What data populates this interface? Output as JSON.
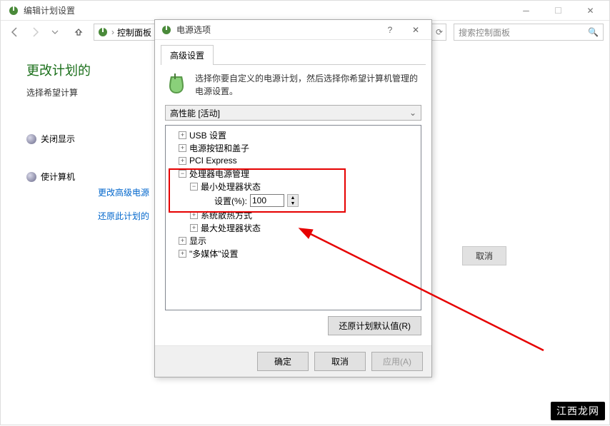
{
  "main": {
    "title": "编辑计划设置",
    "breadcrumb": {
      "level1": "控制面板"
    },
    "search_placeholder": "搜索控制面板",
    "heading": "更改计划的",
    "subheading": "选择希望计算",
    "row1": "关闭显示",
    "row2": "使计算机",
    "link1": "更改高级电源",
    "link2": "还原此计划的",
    "btn_cancel_bg": "取消"
  },
  "dialog": {
    "title": "电源选项",
    "tab": "高级设置",
    "desc": "选择你要自定义的电源计划，然后选择你希望计算机管理的电源设置。",
    "plan": "高性能 [活动]",
    "tree": {
      "usb": "USB 设置",
      "power_buttons": "电源按钮和盖子",
      "pci": "PCI Express",
      "cpu": "处理器电源管理",
      "min_state": "最小处理器状态",
      "setting_label": "设置(%):",
      "setting_value": "100",
      "cooling": "系统散热方式",
      "max_state": "最大处理器状态",
      "display": "显示",
      "multimedia": "\"多媒体\"设置"
    },
    "restore_btn": "还原计划默认值(R)",
    "ok": "确定",
    "cancel": "取消",
    "apply": "应用(A)"
  },
  "watermark": "江西龙网"
}
